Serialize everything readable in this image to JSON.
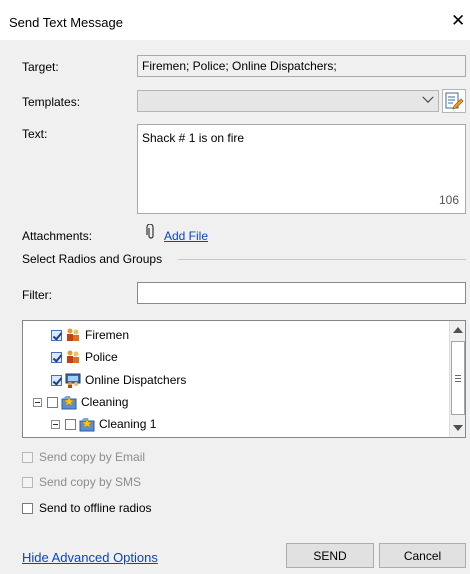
{
  "window": {
    "title": "Send Text Message",
    "close_symbol": "✕"
  },
  "form": {
    "target_label": "Target:",
    "target_value": "Firemen; Police; Online Dispatchers;",
    "templates_label": "Templates:",
    "templates_value": "",
    "text_label": "Text:",
    "text_value": "Shack # 1 is on fire",
    "text_remaining": "106",
    "attachments_label": "Attachments:",
    "add_file_label": "Add File",
    "group_title": "Select Radios and Groups",
    "filter_label": "Filter:",
    "filter_value": ""
  },
  "tree": [
    {
      "label": "Firemen",
      "checked": true,
      "icon": "group-icon"
    },
    {
      "label": "Police",
      "checked": true,
      "icon": "group-icon"
    },
    {
      "label": "Online Dispatchers",
      "checked": true,
      "icon": "dispatchers-icon"
    },
    {
      "label": "Cleaning",
      "checked": false,
      "icon": "folder-group-icon",
      "expander": "collapse"
    },
    {
      "label": "Cleaning 1",
      "checked": false,
      "icon": "folder-group-icon",
      "expander": "collapse"
    }
  ],
  "options": {
    "send_copy_email": {
      "label": "Send copy by Email",
      "checked": false,
      "enabled": false
    },
    "send_copy_sms": {
      "label": "Send copy by SMS",
      "checked": false,
      "enabled": false
    },
    "send_offline": {
      "label": "Send to offline radios",
      "checked": false,
      "enabled": true
    }
  },
  "footer": {
    "hide_advanced": "Hide Advanced Options",
    "send": "SEND",
    "cancel": "Cancel"
  }
}
